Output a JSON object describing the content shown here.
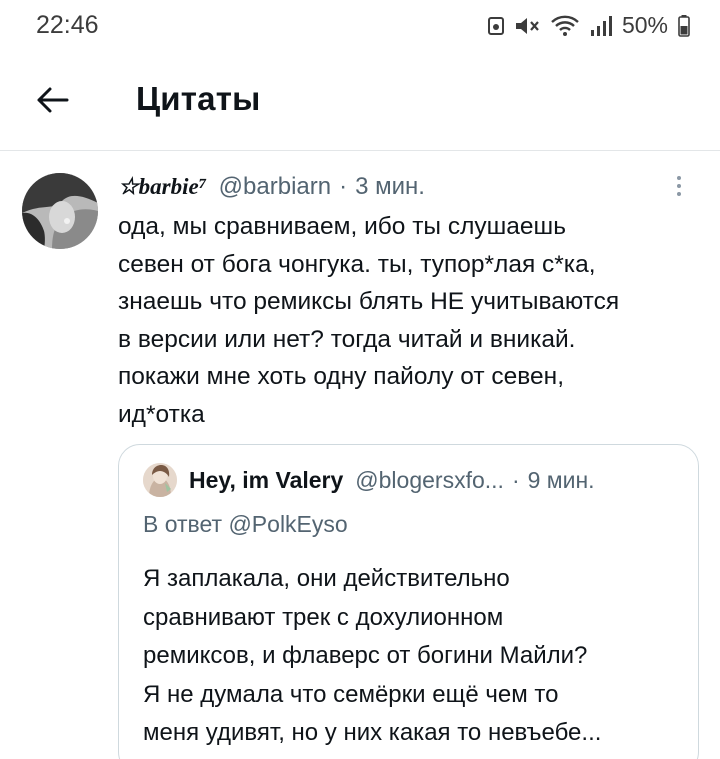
{
  "status_bar": {
    "time": "22:46",
    "battery_percent": "50%",
    "icons": [
      "photo-notification-icon",
      "mute-icon",
      "wifi-icon",
      "signal-icon",
      "battery-icon"
    ]
  },
  "header": {
    "back_icon": "arrow-left-icon",
    "title": "Цитаты"
  },
  "tweet": {
    "display_name": "☆barbie⁷",
    "handle": "@barbiarn",
    "separator": "·",
    "time": "3 мин.",
    "more_icon": "more-vertical-icon",
    "text_lines": [
      "ода, мы сравниваем, ибо  ты слушаешь",
      "севен от бога чонгука. ты, тупор*лая с*ка,",
      "знаешь что ремиксы блять НЕ учитываются",
      "в версии или нет? тогда читай и вникай.",
      "покажи мне хоть одну пайолу от севен,",
      "ид*отка"
    ]
  },
  "quoted_tweet": {
    "display_name": "Hey, im Valery",
    "handle": "@blogersxfo...",
    "separator": "·",
    "time": "9 мин.",
    "reply_to": "В ответ @PolkEyso",
    "text_lines": [
      "Я заплакала,  они действительно",
      "сравнивают трек с дохулионном",
      "ремиксов, и флаверс от богини Майли?",
      "Я не думала что семёрки ещё чем то",
      "меня удивят, но у них какая то невъебе..."
    ]
  },
  "colors": {
    "text_primary": "#0f1419",
    "text_secondary": "#536471",
    "divider": "#e3e6e8",
    "card_border": "#cfd9de"
  }
}
